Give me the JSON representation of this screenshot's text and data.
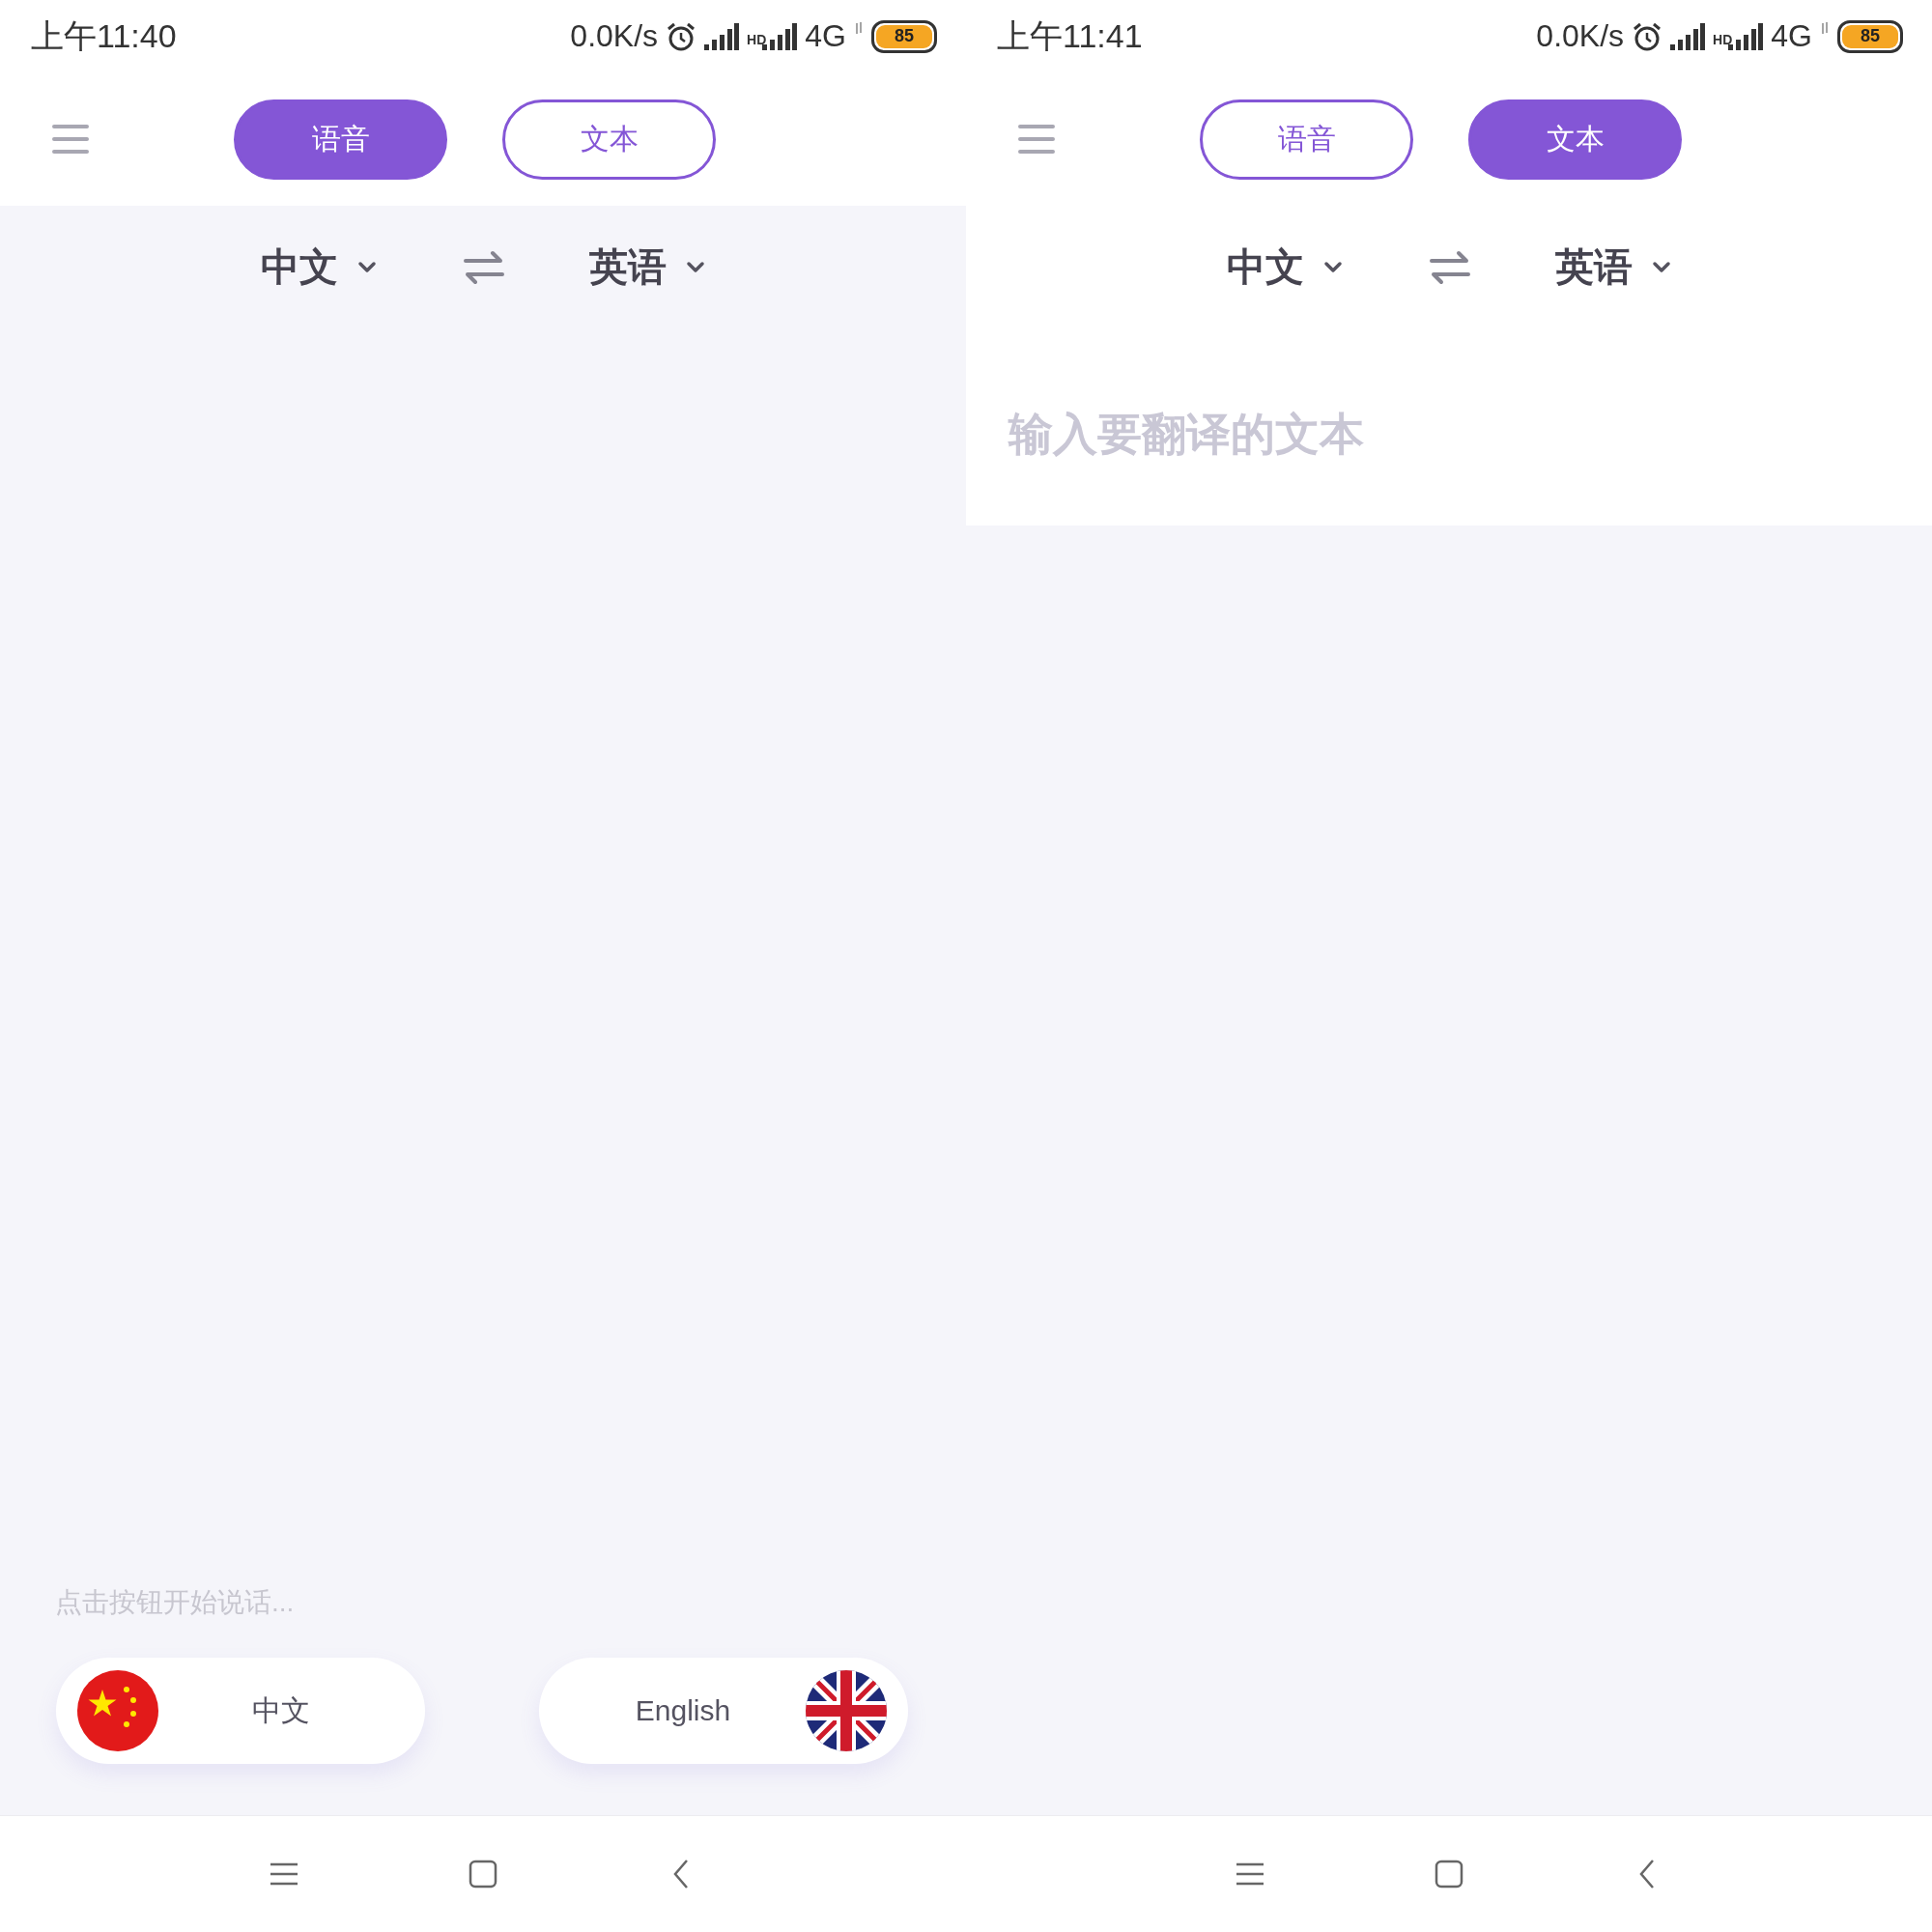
{
  "screens": [
    {
      "kind": "voice",
      "status_bar": {
        "time": "上午11:40",
        "net_speed": "0.0K/s",
        "hd": "HD",
        "network": "4G",
        "battery": "85"
      },
      "tabs": [
        {
          "label": "语音",
          "selected": true
        },
        {
          "label": "文本",
          "selected": false
        }
      ],
      "languages": {
        "source": "中文",
        "target": "英语"
      },
      "hint": "点击按钮开始说话...",
      "speak_buttons": [
        {
          "label": "中文",
          "kind": "cn"
        },
        {
          "label": "English",
          "kind": "gb"
        }
      ]
    },
    {
      "kind": "text",
      "status_bar": {
        "time": "上午11:41",
        "net_speed": "0.0K/s",
        "hd": "HD",
        "network": "4G",
        "battery": "85"
      },
      "tabs": [
        {
          "label": "语音",
          "selected": false
        },
        {
          "label": "文本",
          "selected": true
        }
      ],
      "languages": {
        "source": "中文",
        "target": "英语"
      },
      "placeholder": "输入要翻译的文本"
    }
  ]
}
